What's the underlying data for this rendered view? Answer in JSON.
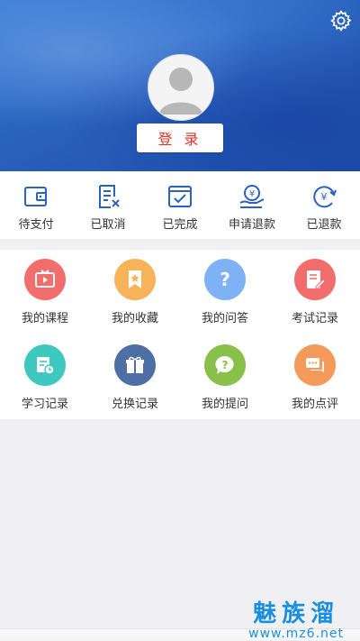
{
  "header": {
    "login_label": "登 录",
    "settings_icon": "gear-icon",
    "avatar_icon": "user-avatar-icon"
  },
  "orders": [
    {
      "label": "待支付",
      "icon": "wallet-icon"
    },
    {
      "label": "已取消",
      "icon": "cancelled-doc-icon"
    },
    {
      "label": "已完成",
      "icon": "check-box-icon"
    },
    {
      "label": "申请退款",
      "icon": "refund-hand-icon"
    },
    {
      "label": "已退款",
      "icon": "refunded-cycle-icon"
    }
  ],
  "menu": [
    {
      "label": "我的课程",
      "icon": "tv-play-icon",
      "color": "#f26d6d"
    },
    {
      "label": "我的收藏",
      "icon": "bookmark-star-icon",
      "color": "#f7b35a"
    },
    {
      "label": "我的问答",
      "icon": "question-icon",
      "color": "#7fb2f5"
    },
    {
      "label": "考试记录",
      "icon": "exam-edit-icon",
      "color": "#f26d6d"
    },
    {
      "label": "学习记录",
      "icon": "study-clock-icon",
      "color": "#3ec8c0"
    },
    {
      "label": "兑换记录",
      "icon": "gift-icon",
      "color": "#4e6fa3"
    },
    {
      "label": "我的提问",
      "icon": "ask-bubble-icon",
      "color": "#88c04a"
    },
    {
      "label": "我的点评",
      "icon": "comment-icon",
      "color": "#f39a5a"
    }
  ],
  "colors": {
    "accent_blue": "#2a63bf",
    "login_text": "#e0342a",
    "watermark": "#1a8fe0"
  },
  "watermark": {
    "title": "魅族溜",
    "url": "www.mz6.net"
  }
}
